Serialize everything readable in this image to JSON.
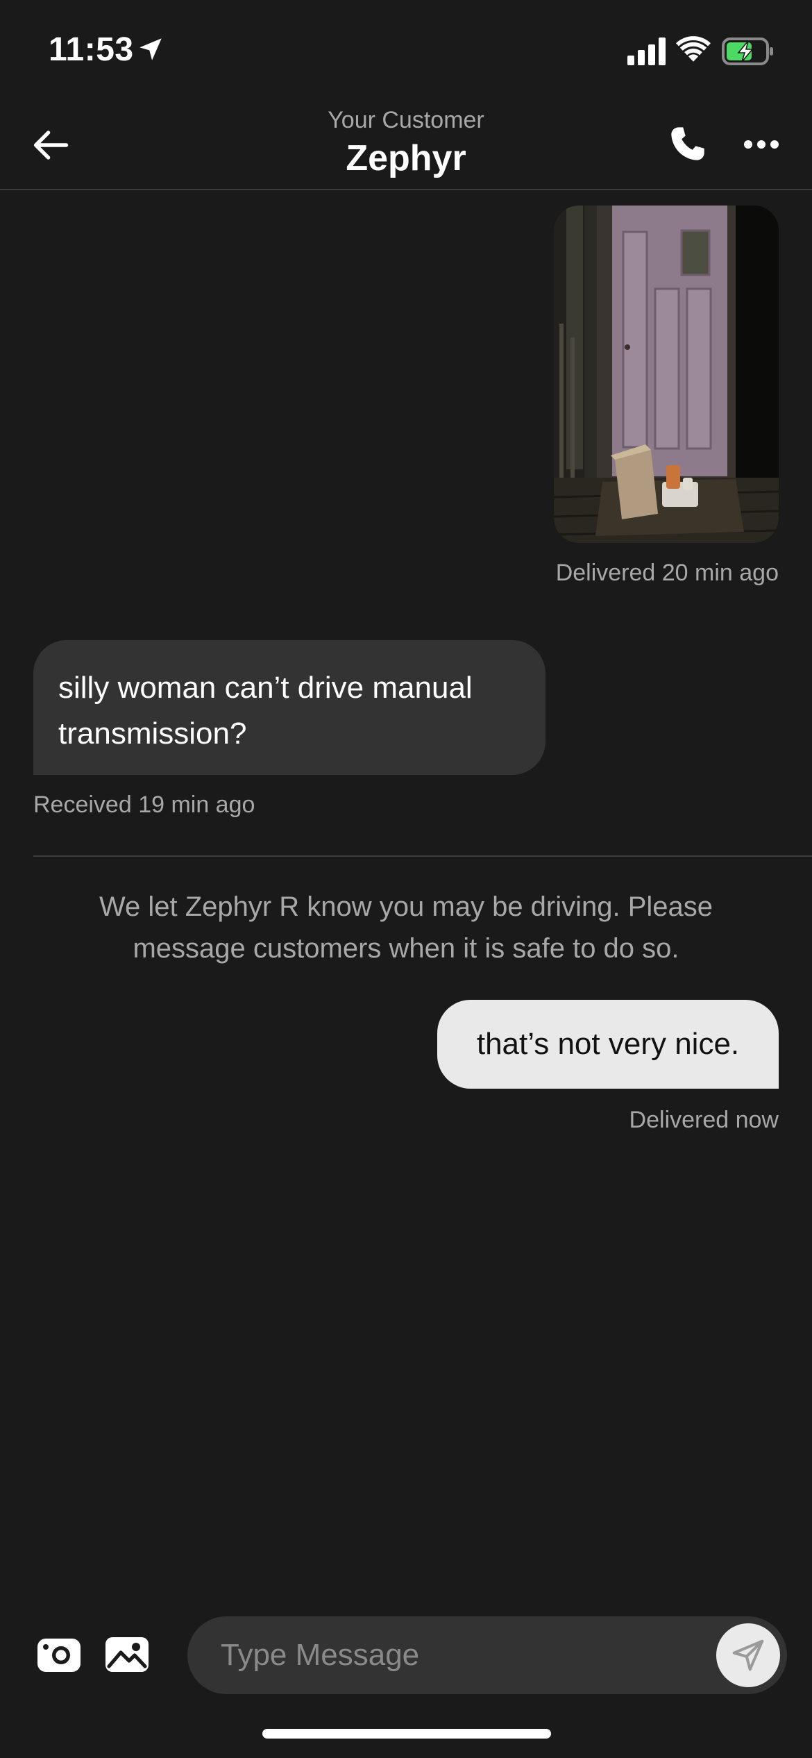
{
  "status_bar": {
    "time": "11:53",
    "icons": [
      "location-arrow-icon",
      "signal-icon",
      "wifi-icon",
      "battery-charging-icon"
    ],
    "battery_color": "#4cd964"
  },
  "header": {
    "subtitle": "Your Customer",
    "title": "Zephyr",
    "icons": [
      "back-arrow-icon",
      "phone-icon",
      "more-icon"
    ]
  },
  "messages": {
    "photo_status": "Delivered 20 min ago",
    "incoming_text": "silly woman can’t drive manual transmission?",
    "incoming_status": "Received 19 min ago",
    "system_note": "We let Zephyr R know you may be driving. Please message customers when it is safe to do so.",
    "outgoing_text": "that’s not very nice.",
    "outgoing_status": "Delivered now"
  },
  "composer": {
    "placeholder": "Type Message",
    "icons": [
      "camera-icon",
      "gallery-icon",
      "send-icon"
    ]
  },
  "colors": {
    "background": "#1a1a1a",
    "incoming_bubble": "#333333",
    "outgoing_bubble": "#e9e9e9",
    "muted_text": "#a8a8a8"
  }
}
